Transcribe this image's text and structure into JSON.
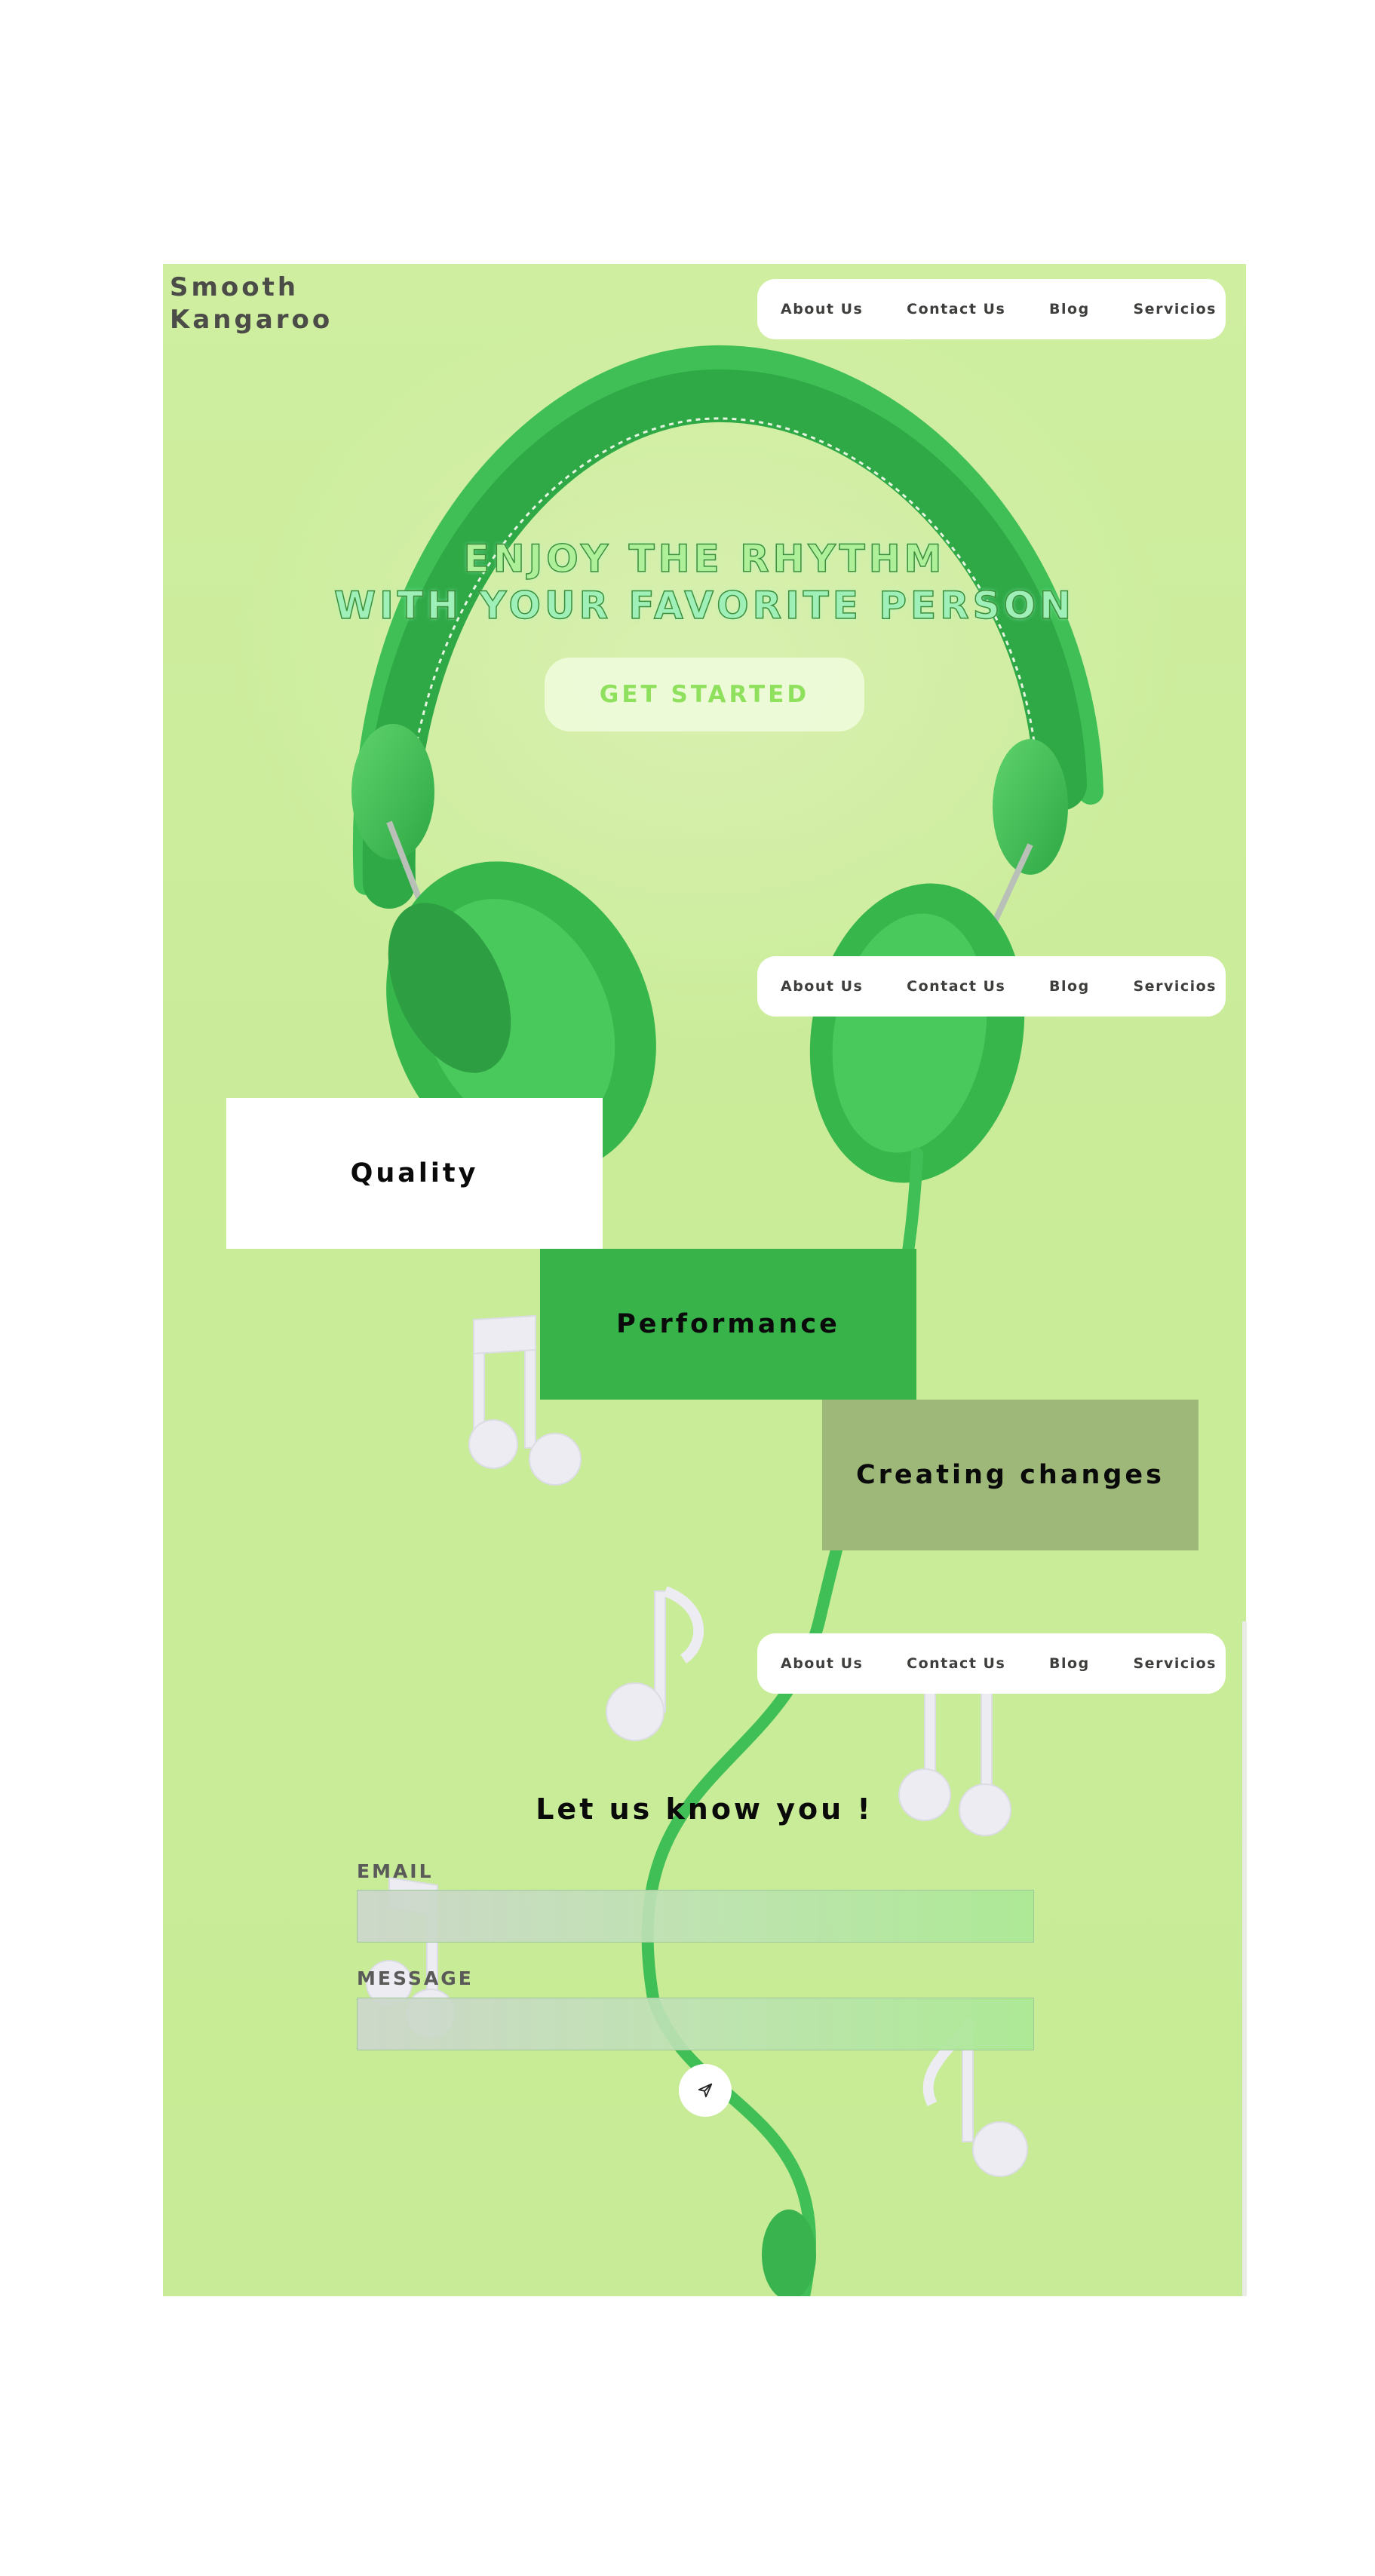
{
  "brand": {
    "line1": "Smooth",
    "line2": "Kangaroo"
  },
  "nav": {
    "items": [
      {
        "label": "About Us"
      },
      {
        "label": "Contact Us"
      },
      {
        "label": "Blog"
      },
      {
        "label": "Servicios"
      }
    ]
  },
  "hero": {
    "title_line1": "ENJOY THE RHYTHM",
    "title_line2": "WITH YOUR FAVORITE PERSON",
    "cta_label": "GET STARTED"
  },
  "features": [
    {
      "label": "Quality"
    },
    {
      "label": "Performance"
    },
    {
      "label": "Creating changes"
    }
  ],
  "contact": {
    "title": "Let us know you !",
    "email_label": "EMAIL",
    "email_value": "",
    "message_label": "MESSAGE",
    "message_value": "",
    "send_icon": "send-icon"
  },
  "colors": {
    "background": "#c9ec98",
    "headphones": "#3fbf55",
    "performance_box": "#37b34a",
    "changes_box": "#9db879",
    "cta_text": "#8fe05c"
  }
}
